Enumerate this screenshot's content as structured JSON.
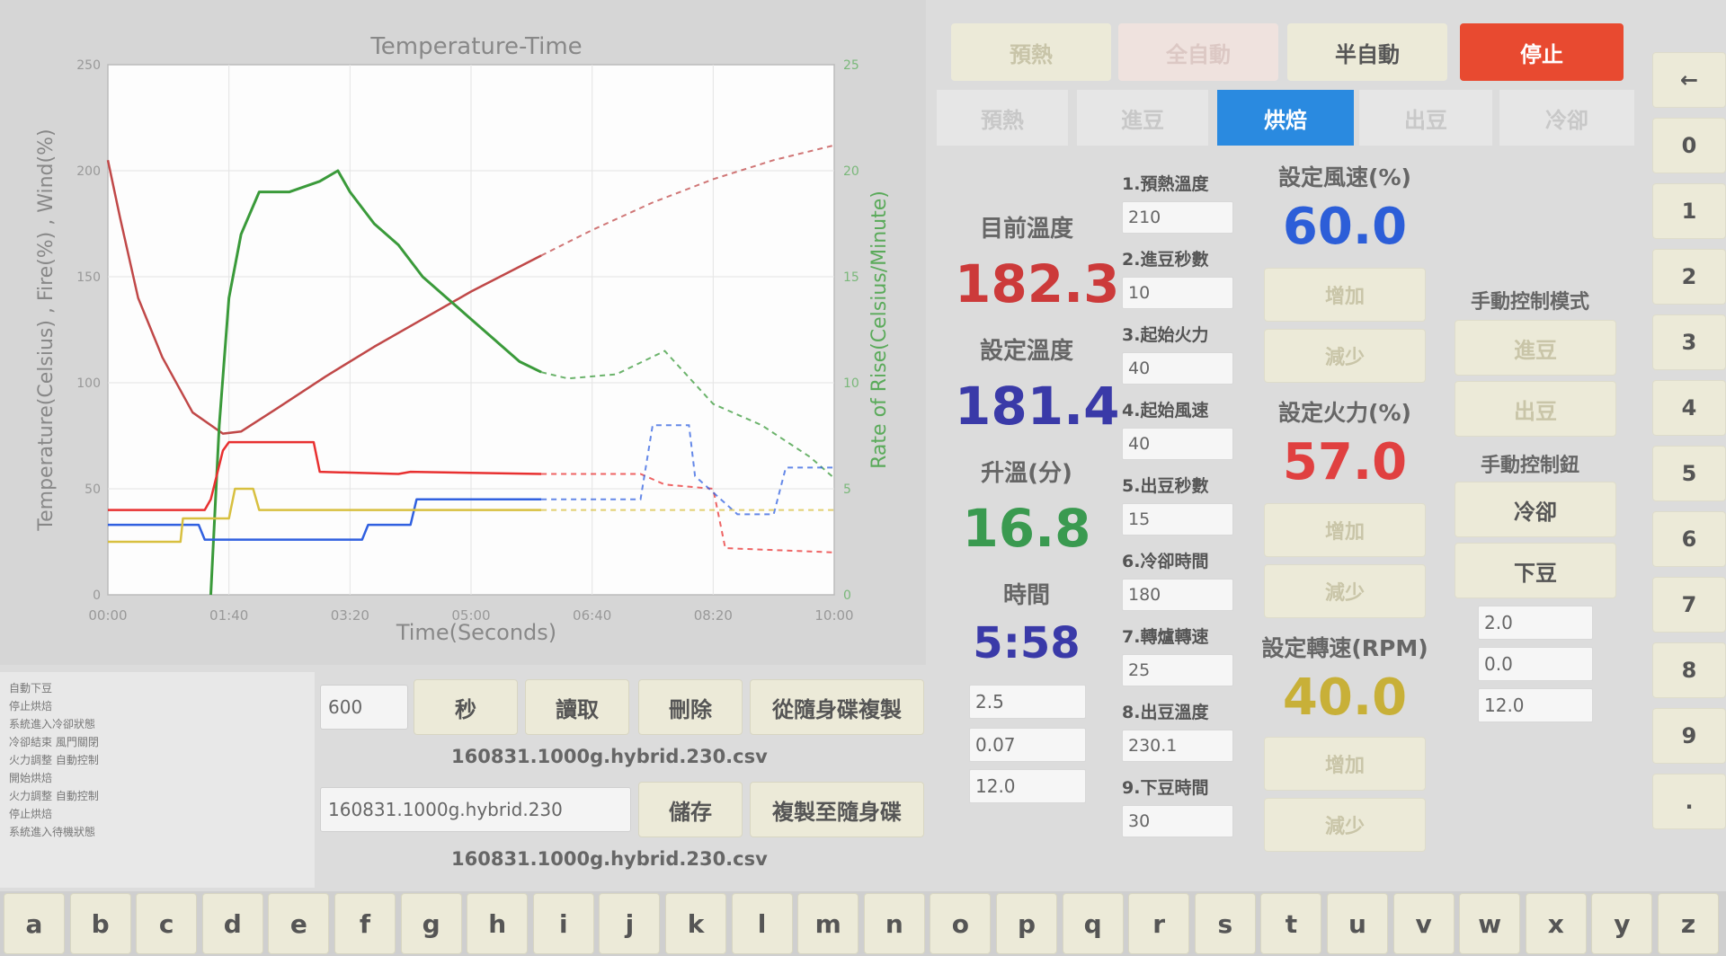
{
  "chart": {
    "title": "Temperature-Time",
    "xlabel": "Time(Seconds)",
    "ylabel_left": "Temperature(Celsius) , Fire(%) , Wind(%)",
    "ylabel_right": "Rate of Rise(Celsius/Minute)",
    "colors": {
      "temp": "#c04848",
      "ror": "#3a9a3a",
      "fire": "#e83030",
      "wind": "#3060e0",
      "drum": "#d8c040",
      "bg": "#fdfdfd",
      "grid": "#e4e4e4"
    }
  },
  "chart_data": {
    "type": "line",
    "title": "Temperature-Time",
    "xlabel": "Time(Seconds)",
    "ylabel": "Temperature(Celsius) , Fire(%) , Wind(%)",
    "ylabel_right": "Rate of Rise(Celsius/Minute)",
    "xlim": [
      0,
      600
    ],
    "ylim": [
      0,
      250
    ],
    "ylim_right": [
      0,
      25
    ],
    "x_ticks": [
      "00:00",
      "01:40",
      "03:20",
      "05:00",
      "06:40",
      "08:20",
      "10:00"
    ],
    "y_ticks": [
      "0",
      "50",
      "100",
      "150",
      "200",
      "250"
    ],
    "y_ticks_right": [
      "0",
      "5",
      "10",
      "15",
      "20",
      "25"
    ],
    "series": [
      {
        "name": "temperature",
        "axis": "left",
        "color": "#c04848",
        "x": [
          0,
          10,
          25,
          45,
          70,
          95,
          110,
          140,
          180,
          220,
          260,
          300,
          358,
          400,
          450,
          500,
          550,
          600
        ],
        "y": [
          205,
          178,
          140,
          112,
          86,
          76,
          77,
          88,
          103,
          117,
          130,
          143,
          160,
          172,
          185,
          196,
          205,
          212
        ]
      },
      {
        "name": "rate of rise",
        "axis": "right",
        "color": "#3a9a3a",
        "x": [
          85,
          92,
          100,
          110,
          125,
          150,
          175,
          190,
          200,
          220,
          240,
          260,
          280,
          300,
          320,
          340,
          358,
          380,
          420,
          460,
          500,
          540,
          580,
          600
        ],
        "y": [
          0,
          8,
          14,
          17,
          19,
          19,
          19.5,
          20,
          19,
          17.5,
          16.5,
          15,
          14,
          13,
          12,
          11,
          10.5,
          10.2,
          10.4,
          11.5,
          9,
          8,
          6.5,
          5.5
        ]
      },
      {
        "name": "fire",
        "axis": "left",
        "color": "#e83030",
        "x": [
          0,
          80,
          85,
          95,
          100,
          170,
          175,
          240,
          250,
          358,
          440,
          460,
          500,
          510,
          600
        ],
        "y": [
          40,
          40,
          45,
          68,
          72,
          72,
          58,
          57,
          58,
          57,
          57,
          52,
          50,
          22,
          20
        ]
      },
      {
        "name": "wind",
        "axis": "left",
        "color": "#3060e0",
        "x": [
          0,
          75,
          80,
          210,
          215,
          250,
          255,
          358,
          440,
          450,
          480,
          485,
          520,
          550,
          560,
          600
        ],
        "y": [
          33,
          33,
          26,
          26,
          33,
          33,
          45,
          45,
          45,
          80,
          80,
          56,
          38,
          38,
          60,
          60
        ]
      },
      {
        "name": "drum",
        "axis": "left",
        "color": "#d8c040",
        "x": [
          0,
          60,
          62,
          100,
          105,
          120,
          125,
          358,
          600
        ],
        "y": [
          25,
          25,
          36,
          36,
          50,
          50,
          40,
          40,
          40
        ]
      }
    ]
  },
  "file_controls": {
    "seconds_value": "600",
    "seconds_button": "秒",
    "read_button": "讀取",
    "delete_button": "刪除",
    "copy_from_button": "從隨身碟複製",
    "loaded_filename": "160831.1000g.hybrid.230.csv",
    "save_input_value": "160831.1000g.hybrid.230",
    "save_button": "儲存",
    "copy_to_button": "複製至隨身碟",
    "saved_filename": "160831.1000g.hybrid.230.csv"
  },
  "log_lines": [
    "自動下豆",
    "停止烘焙",
    "系統進入冷卻狀態",
    "冷卻結束 風門關閉",
    "火力調整 自動控制",
    "開始烘焙",
    "火力調整 自動控制",
    "停止烘焙",
    "系統進入待機狀態"
  ],
  "top_modes": [
    {
      "label": "預熱",
      "bg": "#ecead8",
      "color": "#c8c4a8"
    },
    {
      "label": "全自動",
      "bg": "#efe2de",
      "color": "#dcc8c4"
    },
    {
      "label": "半自動",
      "bg": "#ecead8",
      "color": "#555555"
    },
    {
      "label": "停止",
      "bg": "#e84a30",
      "color": "#ffffff"
    }
  ],
  "phases": [
    {
      "label": "預熱",
      "active": false
    },
    {
      "label": "進豆",
      "active": false
    },
    {
      "label": "烘焙",
      "active": true
    },
    {
      "label": "出豆",
      "active": false
    },
    {
      "label": "冷卻",
      "active": false
    }
  ],
  "status": {
    "current_temp_label": "目前溫度",
    "current_temp": "182.3",
    "set_temp_label": "設定溫度",
    "set_temp": "181.4",
    "ror_label": "升溫(分)",
    "ror": "16.8",
    "time_label": "時間",
    "time": "5:58",
    "colors": {
      "current": "#cc3a3a",
      "set": "#3a3aa8",
      "ror": "#3a9a50",
      "time": "#3a3aa8"
    }
  },
  "extra_fields": [
    "2.5",
    "0.07",
    "12.0"
  ],
  "params": [
    {
      "label": "1.預熱溫度",
      "value": "210"
    },
    {
      "label": "2.進豆秒數",
      "value": "10"
    },
    {
      "label": "3.起始火力",
      "value": "40"
    },
    {
      "label": "4.起始風速",
      "value": "40"
    },
    {
      "label": "5.出豆秒數",
      "value": "15"
    },
    {
      "label": "6.冷卻時間",
      "value": "180"
    },
    {
      "label": "7.轉爐轉速",
      "value": "25"
    },
    {
      "label": "8.出豆溫度",
      "value": "230.1"
    },
    {
      "label": "9.下豆時間",
      "value": "30"
    }
  ],
  "settings": {
    "wind_label": "設定風速(%)",
    "wind_value": "60.0",
    "fire_label": "設定火力(%)",
    "fire_value": "57.0",
    "rpm_label": "設定轉速(RPM)",
    "rpm_value": "40.0",
    "increase": "增加",
    "decrease": "減少",
    "colors": {
      "wind": "#2c5ed8",
      "fire": "#e04040",
      "rpm": "#c8b038"
    }
  },
  "manual": {
    "mode_label": "手動控制模式",
    "button_in": "進豆",
    "button_out": "出豆",
    "control_label": "手動控制鈕",
    "cool_button": "冷卻",
    "drop_button": "下豆",
    "fields": [
      "2.0",
      "0.0",
      "12.0"
    ]
  },
  "numpad": [
    "←",
    "0",
    "1",
    "2",
    "3",
    "4",
    "5",
    "6",
    "7",
    "8",
    "9",
    "."
  ],
  "keyboard": [
    "a",
    "b",
    "c",
    "d",
    "e",
    "f",
    "g",
    "h",
    "i",
    "j",
    "k",
    "l",
    "m",
    "n",
    "o",
    "p",
    "q",
    "r",
    "s",
    "t",
    "u",
    "v",
    "w",
    "x",
    "y",
    "z"
  ]
}
